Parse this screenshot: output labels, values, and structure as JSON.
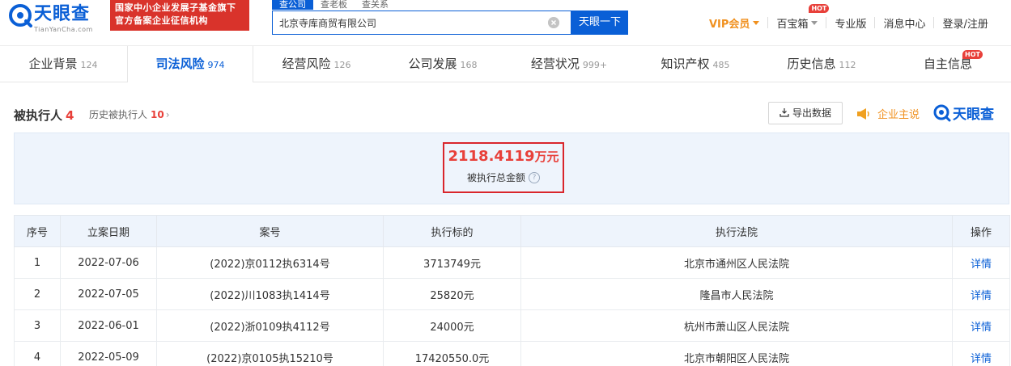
{
  "brand": {
    "name": "天眼查",
    "domain": "TianYanCha.com",
    "slogan_line1": "国家中小企业发展子基金旗下",
    "slogan_line2": "官方备案企业征信机构"
  },
  "search": {
    "tabs": [
      "查公司",
      "查老板",
      "查关系"
    ],
    "query": "北京寺库商贸有限公司",
    "button": "天眼一下"
  },
  "topnav": {
    "vip": "VIP会员",
    "toolbox": "百宝箱",
    "toolbox_badge": "HOT",
    "pro": "专业版",
    "messages": "消息中心",
    "login": "登录/注册"
  },
  "categories": [
    {
      "label": "企业背景",
      "count": "124"
    },
    {
      "label": "司法风险",
      "count": "974"
    },
    {
      "label": "经营风险",
      "count": "126"
    },
    {
      "label": "公司发展",
      "count": "168"
    },
    {
      "label": "经营状况",
      "count": "999+"
    },
    {
      "label": "知识产权",
      "count": "485"
    },
    {
      "label": "历史信息",
      "count": "112"
    },
    {
      "label": "自主信息",
      "count": "",
      "badge": "HOT"
    }
  ],
  "section": {
    "title": "被执行人",
    "count": "4",
    "history_label": "历史被执行人",
    "history_count": "10",
    "export_label": "导出数据",
    "promo_label": "企业主说",
    "brand_small": "天眼查"
  },
  "summary": {
    "amount": "2118.4119",
    "unit": "万元",
    "label": "被执行总金额"
  },
  "table": {
    "headers": [
      "序号",
      "立案日期",
      "案号",
      "执行标的",
      "执行法院",
      "操作"
    ],
    "rows": [
      [
        "1",
        "2022-07-06",
        "(2022)京0112执6314号",
        "3713749元",
        "北京市通州区人民法院",
        "详情"
      ],
      [
        "2",
        "2022-07-05",
        "(2022)川1083执1414号",
        "25820元",
        "隆昌市人民法院",
        "详情"
      ],
      [
        "3",
        "2022-06-01",
        "(2022)浙0109执4112号",
        "24000元",
        "杭州市萧山区人民法院",
        "详情"
      ],
      [
        "4",
        "2022-05-09",
        "(2022)京0105执15210号",
        "17420550.0元",
        "北京市朝阳区人民法院",
        "详情"
      ]
    ]
  },
  "colors": {
    "brand_blue": "#0a5fd6",
    "alert_red": "#e8403a",
    "vip_orange": "#f0901e"
  }
}
